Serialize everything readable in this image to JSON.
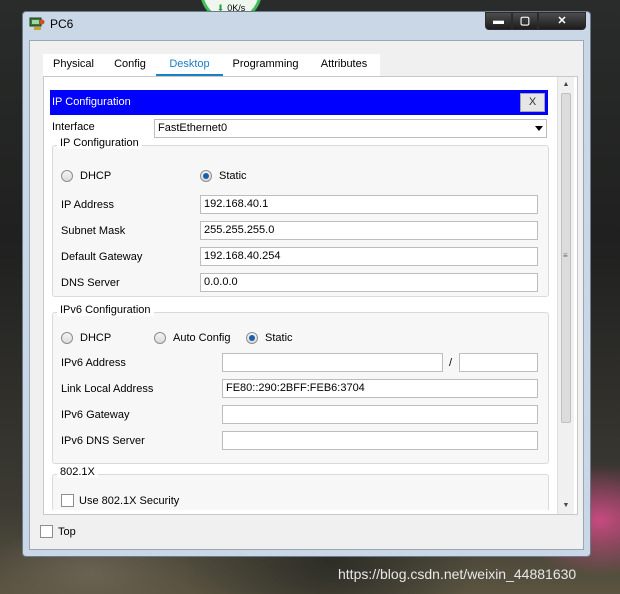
{
  "speed_widget": {
    "label": "0K/s"
  },
  "window": {
    "title": "PC6",
    "controls": {
      "minimize": "▬",
      "maximize": "▢",
      "close": "✕"
    }
  },
  "tabs": [
    {
      "label": "Physical",
      "active": false
    },
    {
      "label": "Config",
      "active": false
    },
    {
      "label": "Desktop",
      "active": true
    },
    {
      "label": "Programming",
      "active": false
    },
    {
      "label": "Attributes",
      "active": false
    }
  ],
  "ip_config": {
    "header": "IP Configuration",
    "close_label": "X",
    "interface_label": "Interface",
    "interface_value": "FastEthernet0",
    "ipv4": {
      "title": "IP Configuration",
      "dhcp_label": "DHCP",
      "static_label": "Static",
      "mode": "Static",
      "ip_address_label": "IP Address",
      "ip_address": "192.168.40.1",
      "subnet_mask_label": "Subnet Mask",
      "subnet_mask": "255.255.255.0",
      "gateway_label": "Default Gateway",
      "gateway": "192.168.40.254",
      "dns_label": "DNS Server",
      "dns": "0.0.0.0"
    },
    "ipv6": {
      "title": "IPv6 Configuration",
      "dhcp_label": "DHCP",
      "auto_label": "Auto Config",
      "static_label": "Static",
      "mode": "Static",
      "address_label": "IPv6 Address",
      "address": "",
      "prefix_separator": "/",
      "prefix": "",
      "link_local_label": "Link Local Address",
      "link_local": "FE80::290:2BFF:FEB6:3704",
      "gateway_label": "IPv6 Gateway",
      "gateway": "",
      "dns_label": "IPv6 DNS Server",
      "dns": ""
    },
    "dot1x": {
      "title": "802.1X",
      "use_label": "Use 802.1X Security",
      "checked": false
    }
  },
  "footer": {
    "top_label": "Top",
    "top_checked": false
  },
  "watermark": "https://blog.csdn.net/weixin_44881630",
  "colors": {
    "header_blue": "#0000ff",
    "tab_active": "#1a7fc4",
    "radio_dot": "#1b5fa8"
  }
}
